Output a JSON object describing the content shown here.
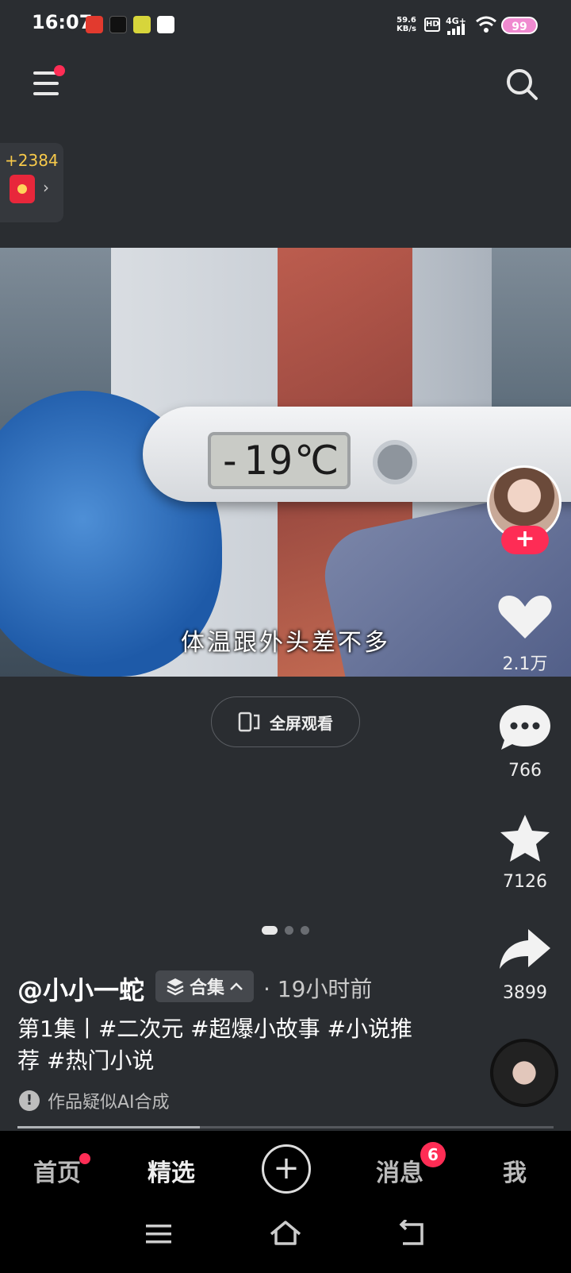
{
  "status_bar": {
    "time": "16:07",
    "network_speed_value": "59.6",
    "network_speed_unit": "KB/s",
    "hd": "HD",
    "signal": "4G+",
    "battery": "99"
  },
  "top_bar": {
    "menu_icon": "menu-icon",
    "search_icon": "search-icon"
  },
  "reward": {
    "count": "+2384",
    "arrow": "›"
  },
  "video": {
    "thermometer_reading": "-19℃",
    "subtitle": "体温跟外头差不多"
  },
  "fullscreen_button": {
    "label": "全屏观看"
  },
  "right_rail": {
    "follow_label": "+",
    "likes": "2.1万",
    "comments": "766",
    "favorites": "7126",
    "shares": "3899"
  },
  "pager": {
    "pages": 3,
    "current": 1
  },
  "post": {
    "author": "@小小一蛇",
    "collection_label": "合集",
    "time_ago": "· 19小时前",
    "caption": "第1集丨#二次元 #超爆小故事 #小说推荐 #热门小说",
    "ai_notice": "作品疑似AI合成",
    "progress": 0.34
  },
  "bottom_nav": {
    "home": "首页",
    "featured": "精选",
    "create": "+",
    "messages": "消息",
    "messages_badge": "6",
    "me": "我"
  },
  "colors": {
    "accent": "#fe2c55",
    "background": "#2a2d31",
    "reward_text": "#f7c94a"
  }
}
